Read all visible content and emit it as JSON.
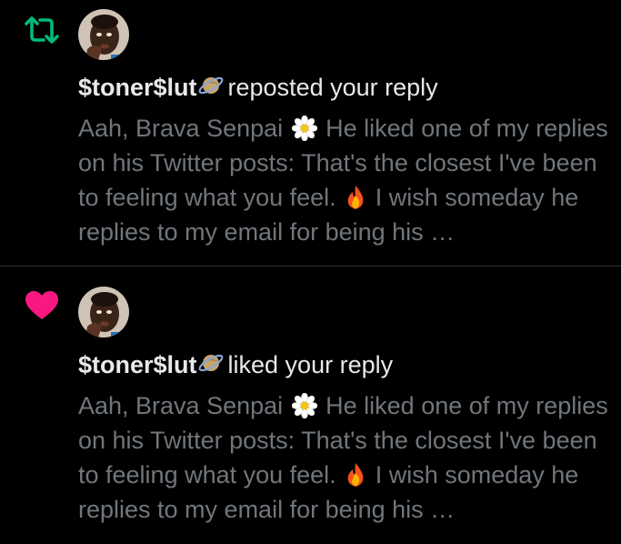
{
  "notifications": [
    {
      "type": "repost",
      "icon": "repost-icon",
      "icon_color": "#00ba7c",
      "username": "$toner$lut",
      "action": "reposted your reply",
      "reply_part1": "Aah, Brava Senpai ",
      "reply_part2": " He liked one of my replies on his Twitter posts: That's the closest I've been to feeling what you feel. ",
      "reply_part3": " I wish someday he replies to my email for being his …"
    },
    {
      "type": "like",
      "icon": "heart-icon",
      "icon_color": "#f91880",
      "username": "$toner$lut",
      "action": "liked your reply",
      "reply_part1": "Aah, Brava Senpai ",
      "reply_part2": " He liked one of my replies on his Twitter posts: That's the closest I've been to feeling what you feel. ",
      "reply_part3": " I wish someday he replies to my email for being his …"
    }
  ],
  "colors": {
    "background": "#000000",
    "primary_text": "#e7e9ea",
    "secondary_text": "#71767b",
    "divider": "#2f3336"
  }
}
